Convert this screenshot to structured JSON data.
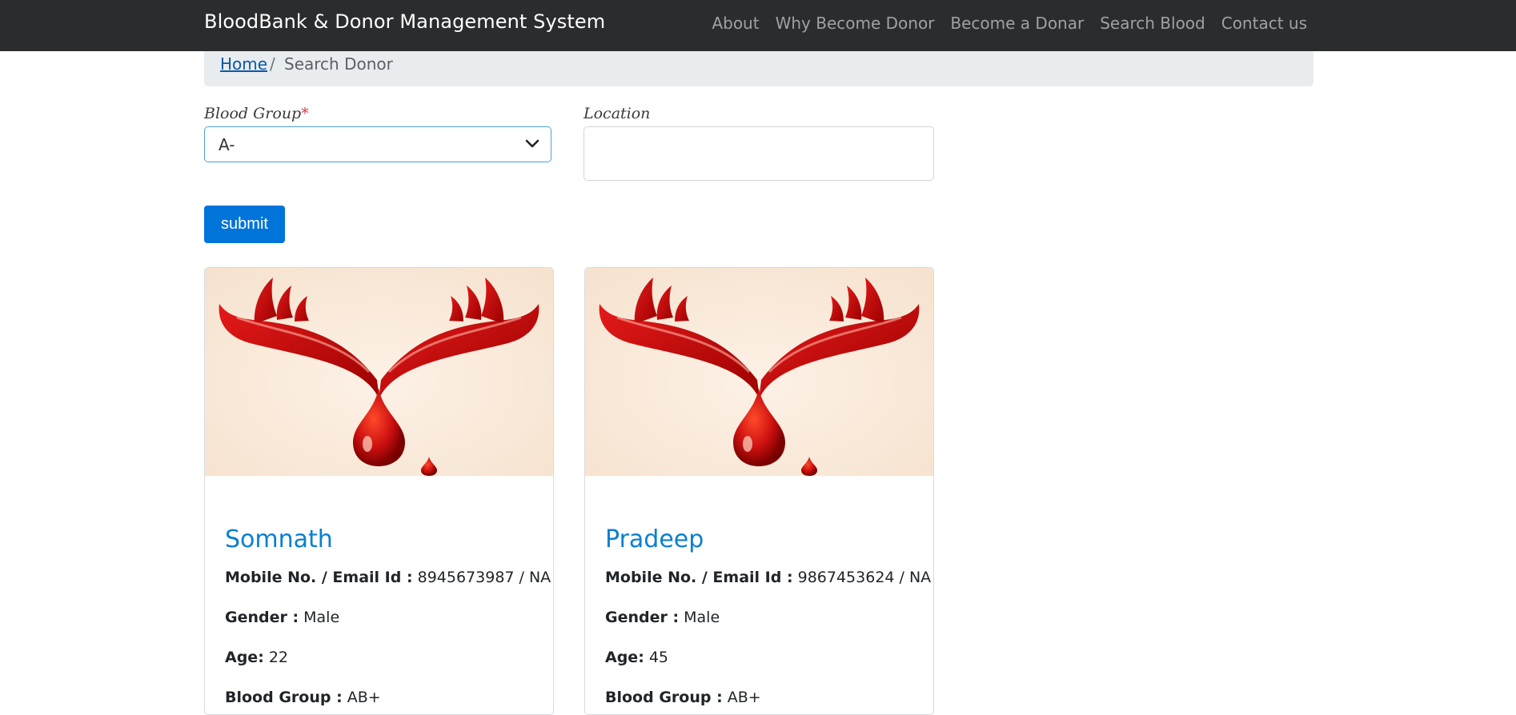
{
  "navbar": {
    "brand": "BloodBank & Donor Management System",
    "links": [
      "About",
      "Why Become Donor",
      "Become a Donar",
      "Search Blood",
      "Contact us"
    ]
  },
  "breadcrumb": {
    "home": "Home",
    "separator": "/",
    "current": "Search Donor"
  },
  "form": {
    "blood_group_label": "Blood Group",
    "required_mark": "*",
    "blood_group_value": "A-",
    "location_label": "Location",
    "location_value": "",
    "submit_label": "submit"
  },
  "donors": [
    {
      "name": "Somnath",
      "contact_label": "Mobile No. / Email Id :",
      "contact_value": "8945673987 / NA",
      "gender_label": "Gender :",
      "gender_value": "Male",
      "age_label": "Age:",
      "age_value": "22",
      "blood_label": "Blood Group :",
      "blood_value": "AB+"
    },
    {
      "name": "Pradeep",
      "contact_label": "Mobile No. / Email Id :",
      "contact_value": "9867453624 / NA",
      "gender_label": "Gender :",
      "gender_value": "Male",
      "age_label": "Age:",
      "age_value": "45",
      "blood_label": "Blood Group :",
      "blood_value": "AB+"
    }
  ],
  "colors": {
    "navbar": "#2b2c2e",
    "accent": "#0074d9",
    "donor_name": "#0a7fd0",
    "required": "#dc3545",
    "logo_red": "#cc1010"
  },
  "icons": {
    "select_arrow": "chevron-down-icon",
    "donor_image": "hands-blood-drop-logo"
  }
}
